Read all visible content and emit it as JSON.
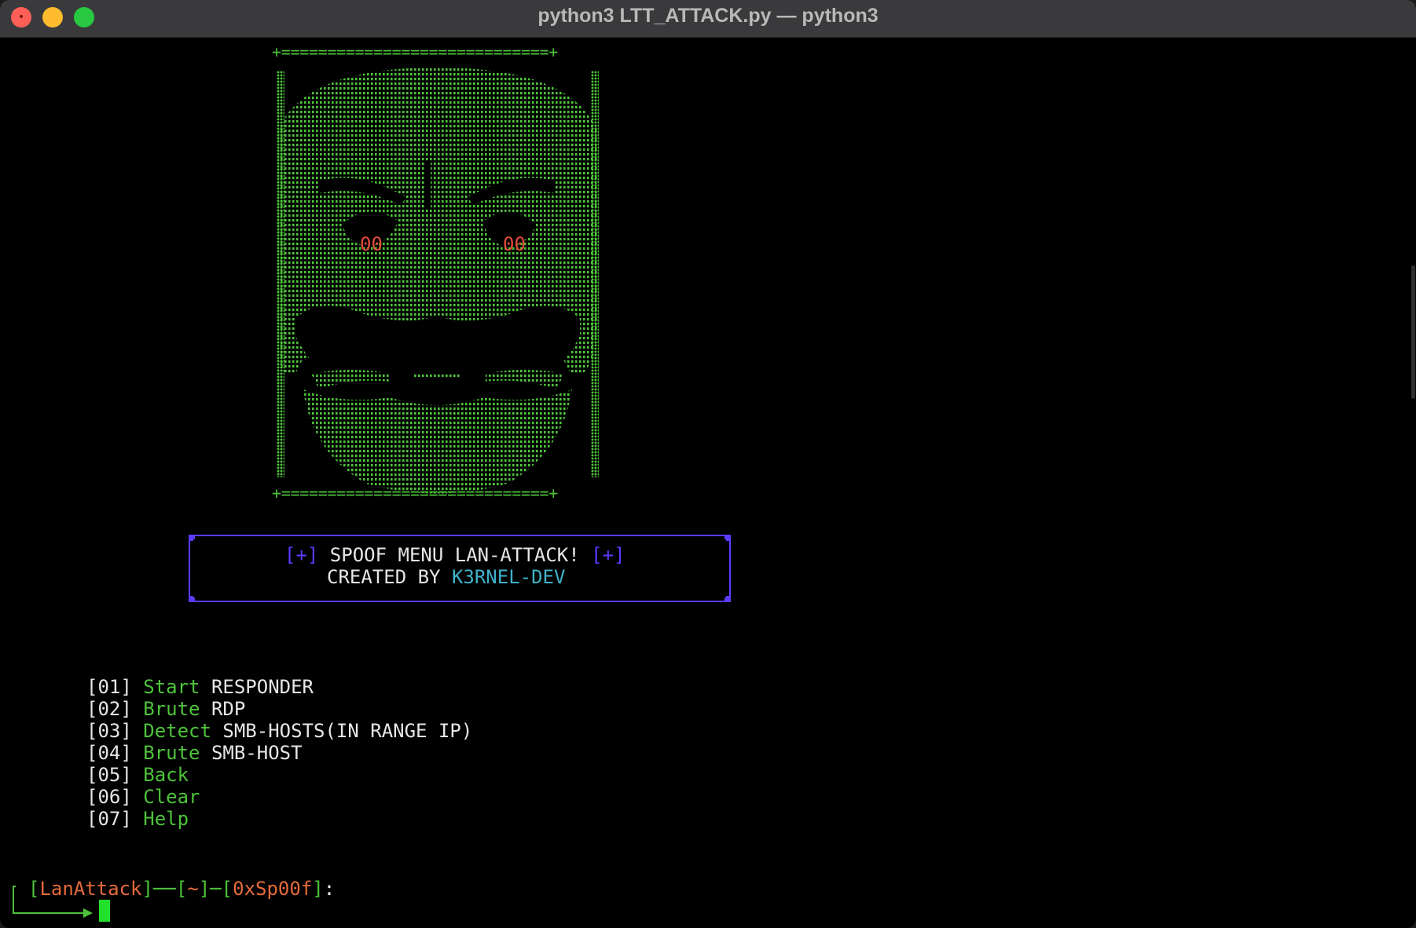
{
  "window": {
    "title": "python3 LTT_ATTACK.py — python3"
  },
  "art": {
    "top_rule": "+=============================+",
    "bottom_rule": "+=============================+",
    "eye_left": "00",
    "eye_right": "00",
    "color": "#4ec23b",
    "eye_color": "#e04b3a"
  },
  "banner": {
    "plus_left": "[+]",
    "line1": " SPOOF MENU LAN-ATTACK! ",
    "plus_right": "[+]",
    "line2_prefix": "CREATED BY ",
    "author": "K3RNEL-DEV",
    "border_color": "#5a3bff"
  },
  "menu": [
    {
      "num": "[01]",
      "verb": "Start",
      "obj": "RESPONDER"
    },
    {
      "num": "[02]",
      "verb": "Brute",
      "obj": "RDP"
    },
    {
      "num": "[03]",
      "verb": "Detect",
      "obj": "SMB-HOSTS(IN RANGE IP)"
    },
    {
      "num": "[04]",
      "verb": "Brute",
      "obj": "SMB-HOST"
    },
    {
      "num": "[05]",
      "verb": "Back",
      "obj": ""
    },
    {
      "num": "[06]",
      "verb": "Clear",
      "obj": ""
    },
    {
      "num": "[07]",
      "verb": "Help",
      "obj": ""
    }
  ],
  "prompt": {
    "open1": "[",
    "name": "LanAttack",
    "close1": "]",
    "dash1": "──",
    "open2": "[",
    "dir": "~",
    "close2": "]",
    "dash2": "─",
    "open3": "[",
    "tag": "0xSp00f",
    "close3": "]",
    "colon": ":"
  }
}
